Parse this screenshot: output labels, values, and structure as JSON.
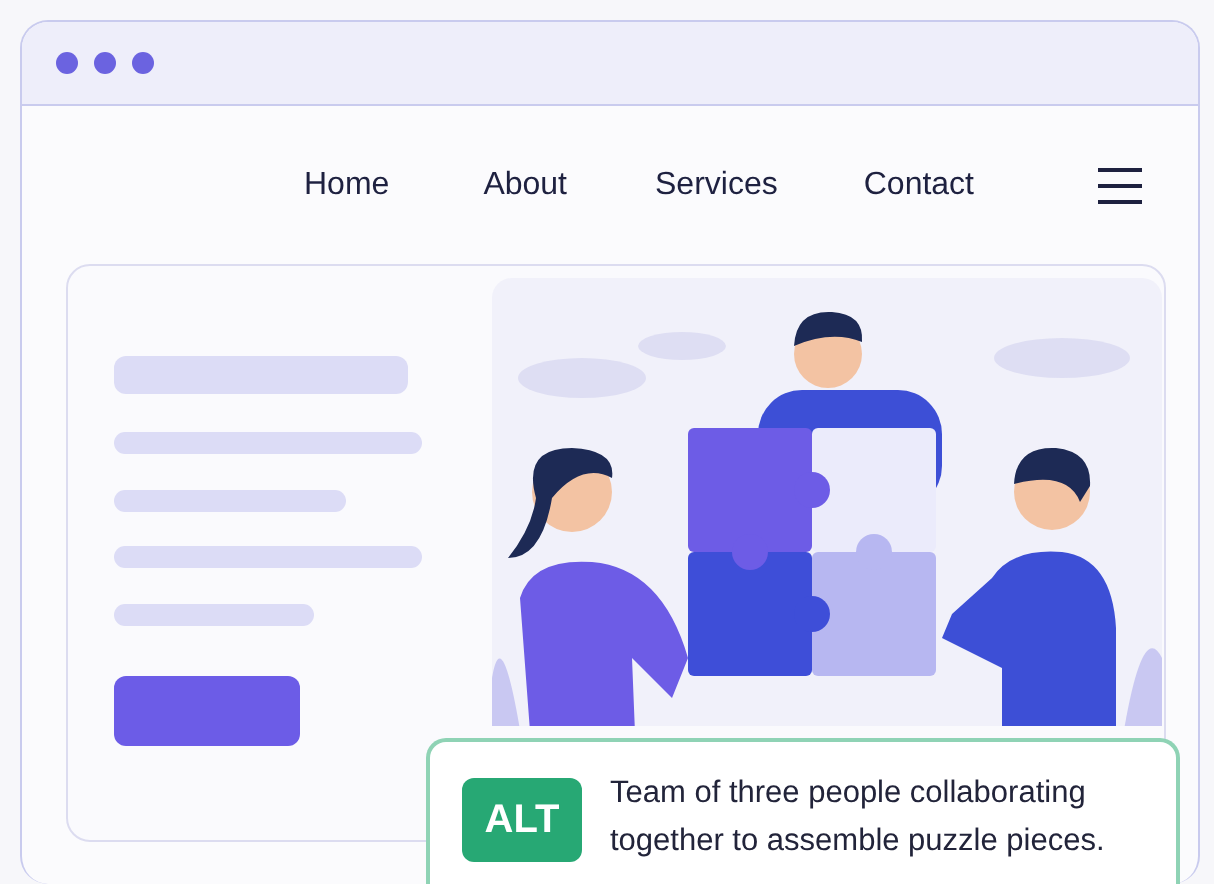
{
  "nav_links": [
    {
      "label": "Home"
    },
    {
      "label": "About"
    },
    {
      "label": "Services"
    },
    {
      "label": "Contact"
    }
  ],
  "alt_caption": {
    "badge": "ALT",
    "text": "Team of three people collaborating together to assemble puzzle pieces."
  }
}
